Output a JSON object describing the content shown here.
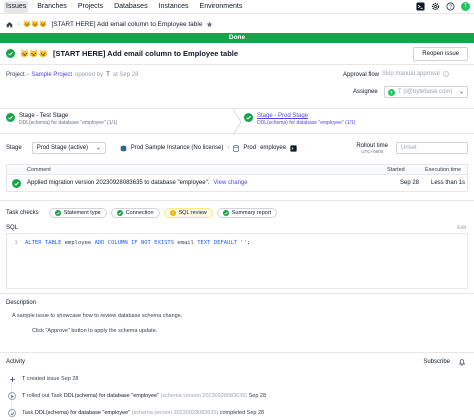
{
  "nav": {
    "items": [
      "Issues",
      "Branches",
      "Projects",
      "Databases",
      "Instances",
      "Environments"
    ],
    "avatar_initial": "T"
  },
  "breadcrumb": {
    "emoji": "🐱🐱🐱",
    "title": "[START HERE] Add email column to Employee table"
  },
  "banner": {
    "text": "Done"
  },
  "issue": {
    "emoji": "🐱🐱🐱",
    "title": "[START HERE] Add email column to Employee table",
    "reopen_label": "Reopen issue",
    "project_prefix": "Project -",
    "project_name": "Sample Project",
    "opened_by": "opened by",
    "opener": "T",
    "opened_at": "at Sep 28"
  },
  "approval": {
    "label": "Approval flow",
    "value": "Skip manual approval",
    "assignee_label": "Assignee",
    "assignee_initial": "T",
    "assignee_value": "T (t@bytebase.com)"
  },
  "stages": [
    {
      "name": "Stage - Test Stage",
      "task": "DDL(schema) for database \"employee\" (1/1)"
    },
    {
      "name": "Stage - Prod Stage",
      "task": "DDL(schema) for database \"employee\" (1/1)"
    }
  ],
  "stage_row": {
    "label": "Stage",
    "selected": "Prod Stage (active)",
    "instance": "Prod Sample Instance (No license)",
    "db_prefix": "Prod",
    "database": "employee",
    "rollout_label": "Rollout time",
    "rollout_tz": "UTC+0800",
    "rollout_placeholder": "Unset"
  },
  "task_table": {
    "headers": [
      "Comment",
      "Started",
      "Execution time"
    ],
    "row": {
      "comment": "Applied migration version 20230928083635 to database \"employee\".",
      "link": "View change",
      "started": "Sep 28",
      "duration": "Less than 1s"
    }
  },
  "task_checks": {
    "label": "Task checks",
    "items": [
      "Statement type",
      "Connection",
      "SQL review",
      "Summary report"
    ]
  },
  "sql": {
    "label": "SQL",
    "edit": "Edit",
    "line_no": "1",
    "kw1": "ALTER TABLE",
    "t1": " employee ",
    "kw2": "ADD COLUMN IF NOT EXISTS",
    "t2": " email ",
    "kw3": "TEXT DEFAULT",
    "str": " ''",
    "t3": ";"
  },
  "description": {
    "label": "Description",
    "line1": "A sample issue to showcase how to review database schema change.",
    "line2": "Click \"Approve\" button to apply the schema update."
  },
  "activity": {
    "label": "Activity",
    "subscribe": "Subscribe",
    "items": [
      {
        "actor": "T",
        "text": "created issue Sep 28"
      },
      {
        "actor": "T",
        "text_a": "rolled out Task",
        "task": "DDL(schema) for database \"employee\"",
        "version": "(schema version 20230928083635)",
        "tail": "Sep 28"
      },
      {
        "text_a": "Task",
        "task": "DDL(schema) for database \"employee\"",
        "version": "(schema version 20230928083635)",
        "tail": "completed Sep 28"
      }
    ]
  }
}
